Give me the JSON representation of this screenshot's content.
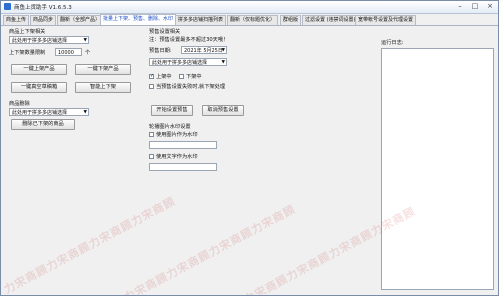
{
  "window": {
    "title": "商鱼上货助手 V1.6.5.3"
  },
  "tabs": [
    "商鱼上传",
    "商品同步",
    "翻新（全部产品）",
    "批量上下架、预售、删除、水印",
    "拼多多店铺扫描列表",
    "翻新（仅标题优化）",
    "群组版",
    "过滤设置 (违禁词设置)",
    "宽带帐号设置及代理设置"
  ],
  "onoff": {
    "section_title": "商品上下架相关",
    "store_select": "此处用于拼多多店铺选择",
    "qty_label": "上下架数量限制",
    "qty_value": "10000",
    "qty_unit": "个",
    "btn_on_all": "一键上架产品",
    "btn_off_all": "一键下架产品",
    "btn_onekey_repair": "一键真空草稿箱",
    "btn_smart": "智能上下架"
  },
  "delete": {
    "section_title": "商品删除",
    "store_select": "此处用于拼多多店铺选择",
    "btn_delete": "删除已下架的商品"
  },
  "presale": {
    "section_title": "预售设置相关",
    "note": "注：预售设置最多不超过30天哦！",
    "date_label": "预售日期:",
    "date_value": "2021年 5月25日",
    "store_select": "此处用于拼多多店铺选择",
    "on_shelf_label": "上架中",
    "off_shelf_label": "下架中",
    "checkbox_label": "当预售设置失败时,就下架处理",
    "btn_start": "开始设置预售",
    "btn_cancel": "取消预售设置"
  },
  "watermark": {
    "section_title": "轮播图片水印设置",
    "image_checkbox": "使用图片作为水印",
    "text_checkbox": "使用文字作为水印"
  },
  "log": {
    "title": "运行日志:"
  },
  "overlay": {
    "watermark_text": "力宋商顾力宋商顾力宋商顾力宋商顾"
  }
}
